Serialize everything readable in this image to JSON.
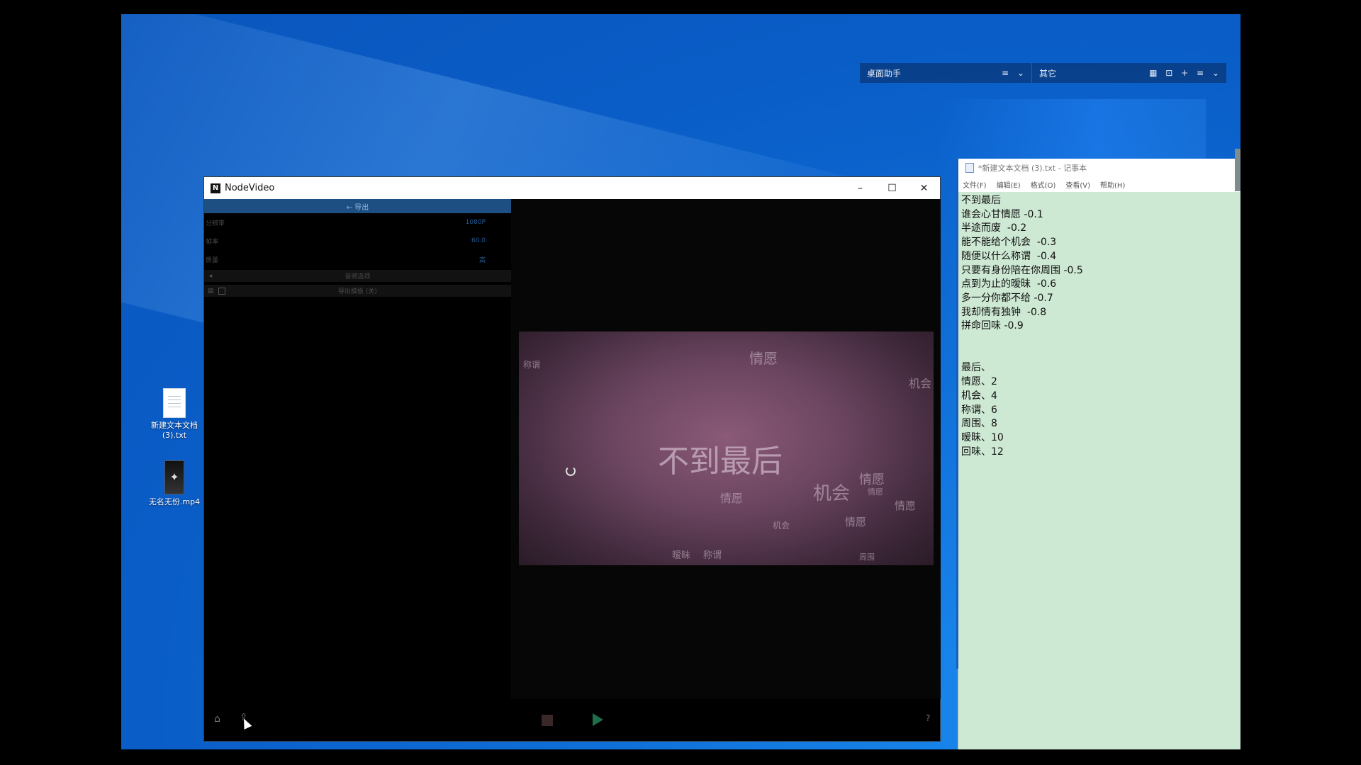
{
  "desktop_widget": {
    "group1_title": "桌面助手",
    "group2_title": "其它",
    "icons": [
      "menu-icon",
      "chevron-down-icon",
      "grid-icon",
      "lock-icon",
      "plus-icon",
      "menu-icon",
      "chevron-down-icon"
    ]
  },
  "desktop_icons": [
    {
      "label": "新建文本文档 (3).txt",
      "icon": "text-file-icon"
    },
    {
      "label": "无名无份.mp4",
      "icon": "video-file-icon"
    }
  ],
  "nodevideo": {
    "title": "NodeVideo",
    "export_header": "← 导出",
    "settings": [
      {
        "label": "分辨率",
        "value": "1080P"
      },
      {
        "label": "帧率",
        "value": "60.0"
      },
      {
        "label": "质量",
        "value": "高"
      }
    ],
    "audio_options_label": "音频选项",
    "export_template_label": "导出模板 (关)",
    "preview": {
      "main_text": "不到最后",
      "words": [
        "情愿",
        "机会",
        "称谓",
        "情愿",
        "情愿",
        "机会",
        "情愿",
        "情愿",
        "机会",
        "周围",
        "情愿",
        "称谓",
        "暧昧"
      ]
    }
  },
  "notepad": {
    "title": "*新建文本文档 (3).txt - 记事本",
    "menu": [
      "文件(F)",
      "编辑(E)",
      "格式(O)",
      "查看(V)",
      "帮助(H)"
    ],
    "lines": [
      "不到最后",
      "谁会心甘情愿 -0.1",
      "半途而废  -0.2",
      "能不能给个机会  -0.3",
      "随便以什么称谓  -0.4",
      "只要有身份陪在你周围 -0.5",
      "点到为止的暧昧  -0.6",
      "多一分你都不给 -0.7",
      "我却情有独钟  -0.8",
      "拼命回味 -0.9",
      "",
      "",
      "最后、",
      "情愿、2",
      "机会、4",
      "称谓、6",
      "周围、8",
      "暧昧、10",
      "回味、12"
    ]
  }
}
